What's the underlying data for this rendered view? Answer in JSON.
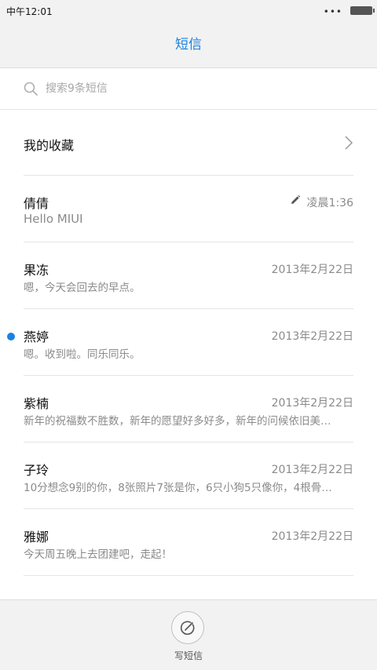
{
  "status_bar": {
    "time": "中午12:01",
    "signal_dots": "•••"
  },
  "header": {
    "title": "短信"
  },
  "search": {
    "placeholder": "搜索9条短信",
    "icon": "search-icon"
  },
  "favorites": {
    "label": "我的收藏",
    "icon": "chevron-right-icon"
  },
  "conversations": [
    {
      "name": "倩倩",
      "preview": "Hello MIUI",
      "time": "凌晨1:36",
      "draft": true,
      "unread": false
    },
    {
      "name": "果冻",
      "preview": "嗯，今天会回去的早点。",
      "time": "2013年2月22日",
      "draft": false,
      "unread": false
    },
    {
      "name": "燕婷",
      "preview": "嗯。收到啦。同乐同乐。",
      "time": "2013年2月22日",
      "draft": false,
      "unread": true
    },
    {
      "name": "紫楠",
      "preview": "新年的祝福数不胜数，新年的愿望好多好多，新年的问候依旧美…",
      "time": "2013年2月22日",
      "draft": false,
      "unread": false
    },
    {
      "name": "子玲",
      "preview": "10分想念9别的你，8张照片7张是你，6只小狗5只像你，4根骨…",
      "time": "2013年2月22日",
      "draft": false,
      "unread": false
    },
    {
      "name": "雅娜",
      "preview": "今天周五晚上去团建吧，走起！",
      "time": "2013年2月22日",
      "draft": false,
      "unread": false
    }
  ],
  "compose": {
    "label": "写短信",
    "icon": "compose-icon"
  },
  "colors": {
    "accent": "#1a82e2",
    "bar_background": "#f2f2f2",
    "secondary_text": "#8a8a8a",
    "divider": "#e5e5e5"
  }
}
